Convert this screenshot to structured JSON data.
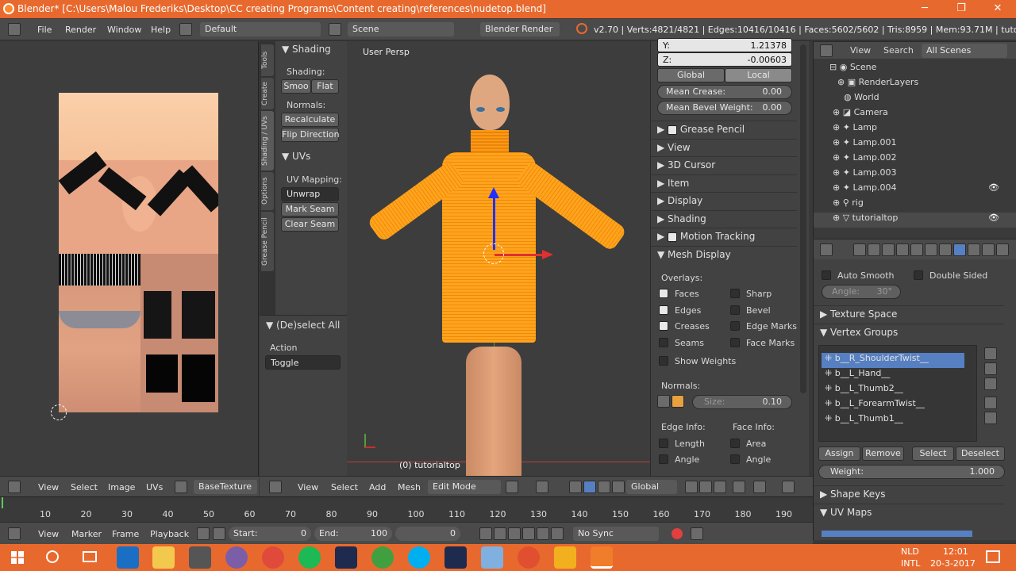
{
  "window": {
    "title": "Blender* [C:\\Users\\Malou Frederiks\\Desktop\\CC creating Programs\\Content creating\\references\\nudetop.blend]",
    "minimize": "─",
    "maximize": "❐",
    "close": "✕"
  },
  "info": {
    "menus": [
      "File",
      "Render",
      "Window",
      "Help"
    ],
    "layout": "Default",
    "scene": "Scene",
    "engine": "Blender Render",
    "stats": "v2.70 | Verts:4821/4821 | Edges:10416/10416 | Faces:5602/5602 | Tris:8959 | Mem:93.71M | tutorialtop"
  },
  "toolshelf": {
    "tabs": [
      "Tools",
      "Create",
      "Shading / UVs",
      "Options",
      "Grease Pencil"
    ],
    "shading_title": "Shading",
    "shading_label": "Shading:",
    "smooth": "Smoo",
    "flat": "Flat",
    "normals_label": "Normals:",
    "recalculate": "Recalculate",
    "flip": "Flip Direction",
    "uvs_title": "UVs",
    "uv_mapping_label": "UV Mapping:",
    "unwrap": "Unwrap",
    "mark_seam": "Mark Seam",
    "clear_seam": "Clear Seam",
    "deselect_title": "(De)select All",
    "action_label": "Action",
    "action_value": "Toggle"
  },
  "viewport": {
    "view_name": "User Persp",
    "object_label": "(0) tutorialtop"
  },
  "properties_panel": {
    "y_label": "Y:",
    "y_value": "1.21378",
    "z_label": "Z:",
    "z_value": "-0.00603",
    "global": "Global",
    "local": "Local",
    "mean_crease_label": "Mean Crease:",
    "mean_crease": "0.00",
    "mean_bevel_label": "Mean Bevel Weight:",
    "mean_bevel": "0.00",
    "panels": [
      "Grease Pencil",
      "View",
      "3D Cursor",
      "Item",
      "Display",
      "Shading",
      "Motion Tracking",
      "Mesh Display"
    ],
    "overlays_label": "Overlays:",
    "overlays_left": [
      "Faces",
      "Edges",
      "Creases",
      "Seams",
      "Show Weights"
    ],
    "overlays_right": [
      "Sharp",
      "Bevel",
      "Edge Marks",
      "Face Marks"
    ],
    "normals_label": "Normals:",
    "size_label": "Size:",
    "size_value": "0.10",
    "edge_info_label": "Edge Info:",
    "edge_info": [
      "Length",
      "Angle"
    ],
    "face_info_label": "Face Info:",
    "face_info": [
      "Area",
      "Angle"
    ]
  },
  "outliner": {
    "view": "View",
    "search": "Search",
    "filter": "All Scenes",
    "rows": [
      "Scene",
      "RenderLayers",
      "World",
      "Camera",
      "Lamp",
      "Lamp.001",
      "Lamp.002",
      "Lamp.003",
      "Lamp.004",
      "rig",
      "tutorialtop"
    ]
  },
  "property_editor": {
    "auto_smooth": "Auto Smooth",
    "double_sided": "Double Sided",
    "angle_label": "Angle:",
    "angle_value": "30°",
    "texture_space": "Texture Space",
    "vertex_groups": "Vertex Groups",
    "groups": [
      "b__R_ShoulderTwist__",
      "b__L_Hand__",
      "b__L_Thumb2__",
      "b__L_ForearmTwist__",
      "b__L_Thumb1__"
    ],
    "assign": "Assign",
    "remove": "Remove",
    "select": "Select",
    "deselect": "Deselect",
    "weight_label": "Weight:",
    "weight_value": "1.000",
    "shape_keys": "Shape Keys",
    "uv_maps": "UV Maps"
  },
  "uv_header": {
    "menus": [
      "View",
      "Select",
      "Image",
      "UVs"
    ],
    "image": "BaseTexture"
  },
  "view3d_header": {
    "menus": [
      "View",
      "Select",
      "Add",
      "Mesh"
    ],
    "mode": "Edit Mode",
    "orientation": "Global"
  },
  "timeline": {
    "ticks": [
      "10",
      "20",
      "30",
      "40",
      "50",
      "60",
      "70",
      "80",
      "90",
      "100",
      "110",
      "120",
      "130",
      "140",
      "150",
      "160",
      "170",
      "180",
      "190"
    ],
    "menus": [
      "View",
      "Marker",
      "Frame",
      "Playback"
    ],
    "start_label": "Start:",
    "start": "0",
    "end_label": "End:",
    "end": "100",
    "current": "0",
    "sync": "No Sync"
  },
  "taskbar": {
    "lang": "NLD",
    "lang2": "INTL",
    "time": "12:01",
    "date": "20-3-2017"
  },
  "colors": {
    "accent": "#e8692e",
    "mesh": "#ff9a10",
    "select_blue": "#5680c2"
  }
}
